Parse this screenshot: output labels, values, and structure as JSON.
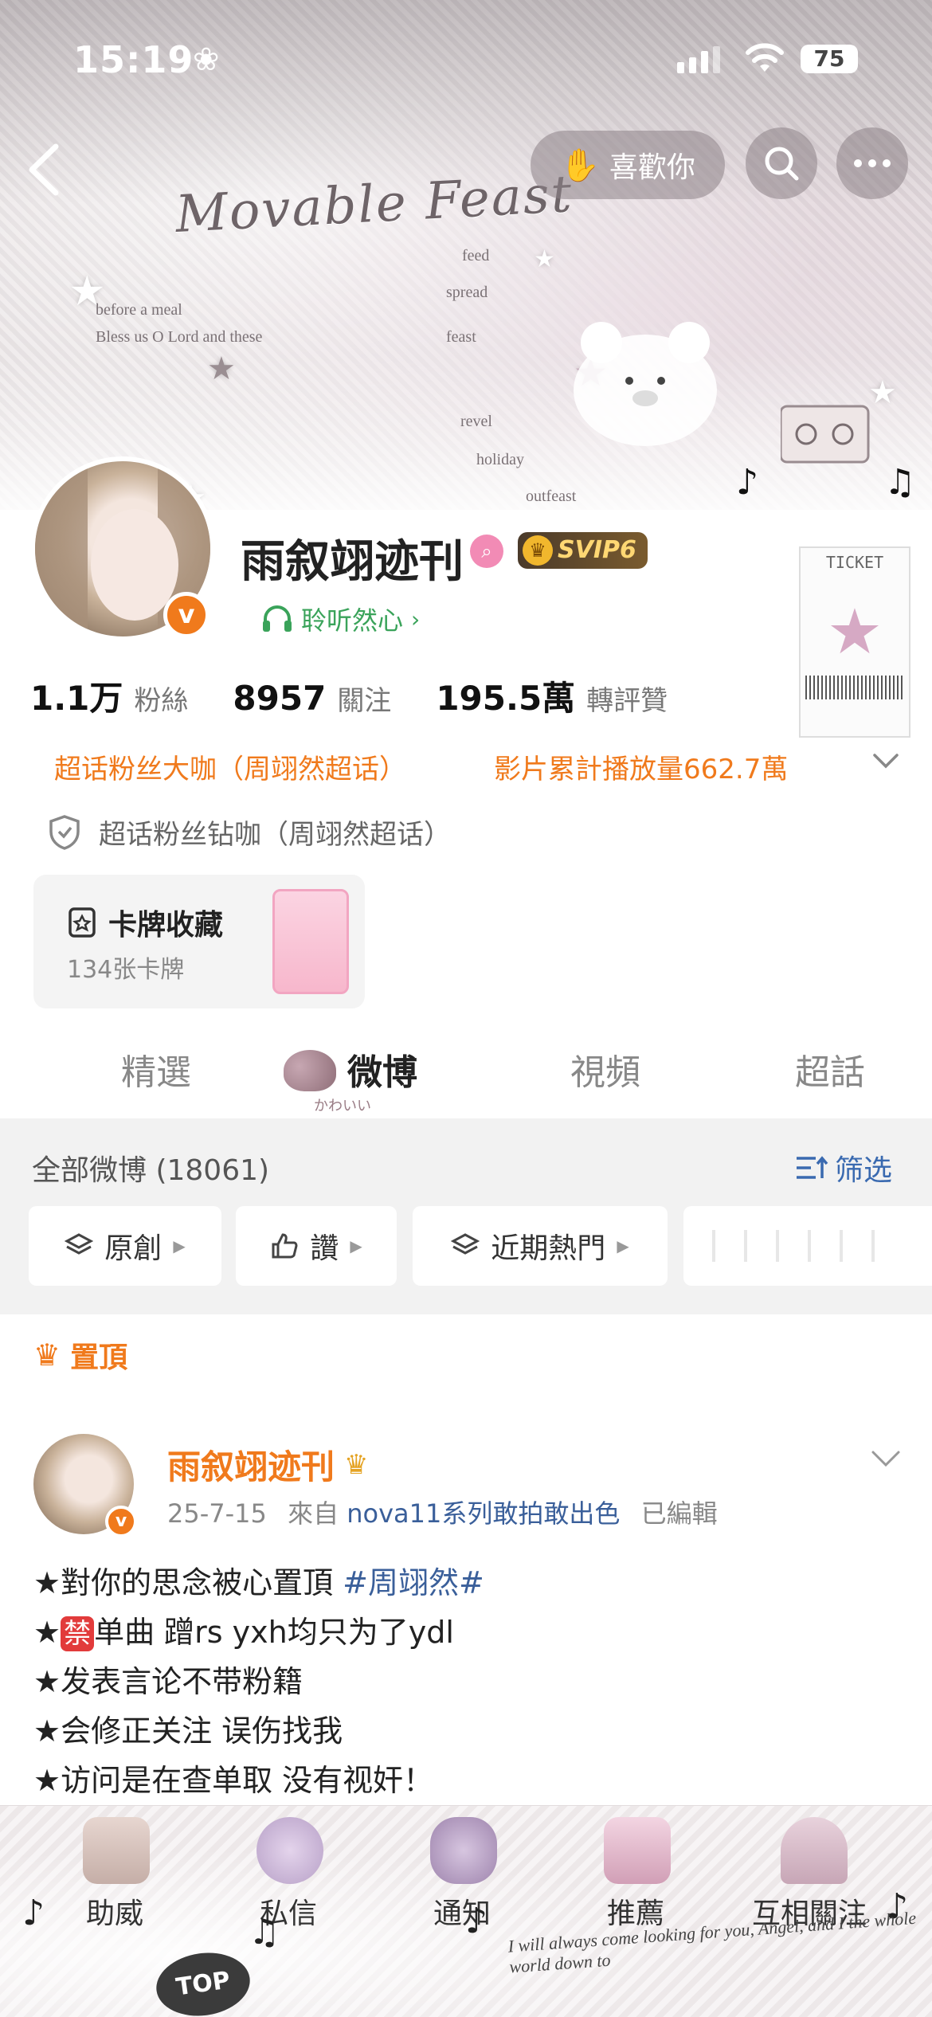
{
  "status_bar": {
    "time": "15:19",
    "battery": "75"
  },
  "banner": {
    "title": "Movable Feast",
    "lines": [
      "before a meal",
      "Bless us O Lord and these",
      "spread",
      "feed",
      "holiday",
      "outfeast",
      "revel",
      "feast"
    ]
  },
  "header": {
    "like_label": "喜歡你"
  },
  "profile": {
    "username": "雨叙翊迹刊",
    "svip_label": "SVIP6",
    "listen_label": "聆听然心",
    "stats": [
      {
        "num": "1.1万",
        "label": "粉絲"
      },
      {
        "num": "8957",
        "label": "關注"
      },
      {
        "num": "195.5萬",
        "label": "轉評贊"
      }
    ],
    "tag_left": "超话粉丝大咖（周翊然超话）",
    "tag_right": "影片累計播放量662.7萬",
    "shield_label": "超话粉丝钻咖（周翊然超话）",
    "ticket_label": "TICKET",
    "card": {
      "title": "卡牌收藏",
      "sub": "134张卡牌"
    }
  },
  "tabs": [
    {
      "label": "精選"
    },
    {
      "label": "微博"
    },
    {
      "label": "視頻"
    },
    {
      "label": "超話"
    }
  ],
  "tab_kawaii": "かわいい",
  "feed": {
    "all_posts": "全部微博 (18061)",
    "filter_label": "筛选",
    "chips": [
      "原創",
      "讚",
      "近期熱門"
    ]
  },
  "pinned_label": "置頂",
  "post": {
    "name": "雨叙翊迹刊",
    "date": "25-7-15",
    "from": "來自",
    "source": "nova11系列敢拍敢出色",
    "edited": "已編輯",
    "line1_prefix": "★對你的思念被心置頂 ",
    "line1_tag": "#周翊然#",
    "line2_ban": "禁",
    "line2_rest": "单曲 蹭rs yxh均只为了ydl",
    "line3": "★发表言论不带粉籍",
    "line4": "★会修正关注 误伤找我",
    "line5": "★访问是在查单取 没有视奸！"
  },
  "bottom_nav": [
    {
      "label": "助威"
    },
    {
      "label": "私信"
    },
    {
      "label": "通知"
    },
    {
      "label": "推薦"
    },
    {
      "label": "互相關注"
    }
  ],
  "top_button": "TOP",
  "bottom_deco": "I will always come looking for you, Angel, and I the whole world down to"
}
